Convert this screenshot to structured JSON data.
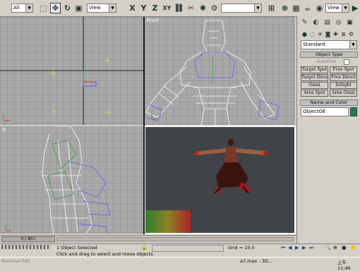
{
  "toolbar": {
    "selection_filter": "All",
    "coord_system": "View",
    "named_selection": "",
    "render_view": "View",
    "buttons": [
      "select-icon",
      "move-icon",
      "rotate-icon",
      "scale-icon",
      "x-axis",
      "y-axis",
      "z-axis",
      "xy-plane",
      "link-icon",
      "unlink-icon",
      "bind-icon",
      "mirror-icon",
      "align-icon"
    ],
    "axis_labels": {
      "x": "X",
      "y": "Y",
      "z": "Z",
      "xy": "XY"
    }
  },
  "viewports": {
    "top_left_label": "",
    "top_right_label": "Front",
    "bottom_left_label": "ft",
    "bottom_right_label": ""
  },
  "command_panel": {
    "object_type_header": "Object Type",
    "autogrid_label": "AutoGrid",
    "category_dropdown": "Standard",
    "buttons": [
      "Target Spot",
      "Free Spot",
      "Target Direct",
      "Free Direct",
      "Omni",
      "InSight",
      "Area Spot",
      "Area Omni"
    ],
    "name_color_header": "Name and Color",
    "object_name": "Object08",
    "object_color": "#1f7a55"
  },
  "timeline": {
    "frame_label": "0 / 807"
  },
  "status_bar": {
    "status_text": "1 Object Selected",
    "prompt_text": "Click and drag to select and move objects",
    "grid_text": "Grid = 10.0",
    "time_text": "上午 11:46",
    "taskbar_item": "a7.max - 3D...",
    "left_taskbar": "Material Edit"
  },
  "colors": {
    "viewport_bg": "#a9a9a9",
    "perspective_bg": "#404347",
    "wire_white": "#ffffff",
    "wire_blue": "#5a5aff",
    "wire_green": "#2ea040"
  }
}
